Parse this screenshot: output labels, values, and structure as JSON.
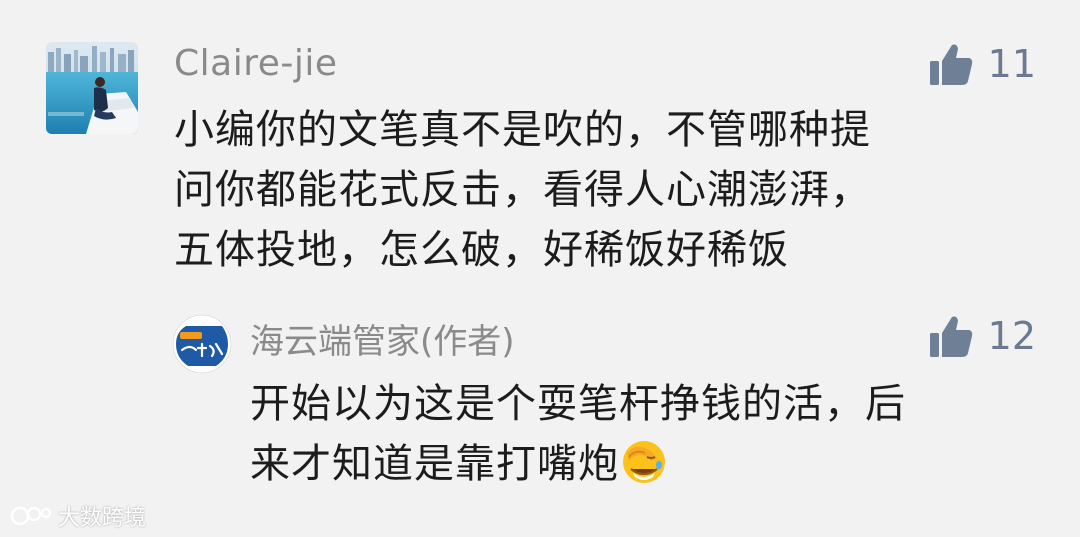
{
  "comment": {
    "author": "Claire-jie",
    "likes": "11",
    "lines": [
      "小编你的文笔真不是吹的，不管哪种提",
      "问你都能花式反击，看得人心潮澎湃，",
      "五体投地，怎么破，好稀饭好稀饭"
    ]
  },
  "reply": {
    "author": "海云端管家(作者)",
    "likes": "12",
    "lines": [
      "开始以为这是个耍笔杆挣钱的活，后",
      "来才知道是靠打嘴炮"
    ],
    "emoji": "facepalm-laughing-emoji"
  },
  "watermark": {
    "text": "大数跨境"
  },
  "colors": {
    "background": "#f2f2f2",
    "name": "#8a8a8a",
    "like": "#6e7f96",
    "body": "#1c1c1c",
    "reply_avatar_blue": "#1f5aa6"
  }
}
